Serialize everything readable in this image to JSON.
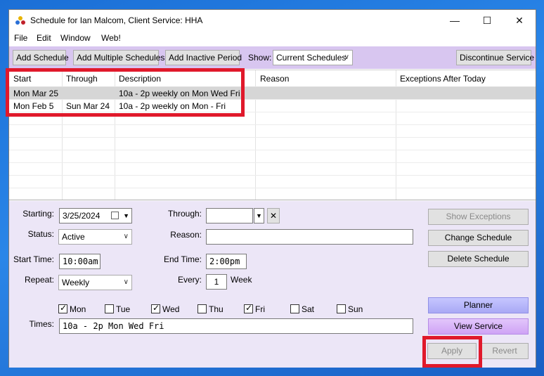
{
  "window": {
    "title": "Schedule for Ian Malcom, Client Service: HHA"
  },
  "menu": [
    "File",
    "Edit",
    "Window",
    "Web!"
  ],
  "toolbar": {
    "add_schedule": "Add Schedule",
    "add_multiple": "Add Multiple Schedules",
    "add_inactive": "Add Inactive Period",
    "show_label": "Show:",
    "show_value": "Current Schedules",
    "discontinue": "Discontinue Service"
  },
  "grid": {
    "columns": [
      "Start",
      "Through",
      "Description",
      "Reason",
      "Exceptions After Today"
    ],
    "rows": [
      {
        "start": "Mon Mar 25",
        "through": "",
        "description": "10a - 2p weekly on Mon Wed Fri",
        "reason": "",
        "exceptions": ""
      },
      {
        "start": "Mon Feb 5",
        "through": "Sun Mar 24",
        "description": "10a - 2p weekly on Mon - Fri",
        "reason": "",
        "exceptions": ""
      }
    ]
  },
  "form": {
    "starting_label": "Starting:",
    "starting_value": "3/25/2024",
    "through_label": "Through:",
    "through_value": "",
    "status_label": "Status:",
    "status_value": "Active",
    "reason_label": "Reason:",
    "reason_value": "",
    "start_time_label": "Start Time:",
    "start_time_value": "10:00am",
    "end_time_label": "End Time:",
    "end_time_value": "2:00pm",
    "repeat_label": "Repeat:",
    "repeat_value": "Weekly",
    "every_label": "Every:",
    "every_value": "1",
    "every_unit": "Week",
    "days": [
      {
        "label": "Mon",
        "checked": true
      },
      {
        "label": "Tue",
        "checked": false
      },
      {
        "label": "Wed",
        "checked": true
      },
      {
        "label": "Thu",
        "checked": false
      },
      {
        "label": "Fri",
        "checked": true
      },
      {
        "label": "Sat",
        "checked": false
      },
      {
        "label": "Sun",
        "checked": false
      }
    ],
    "times_label": "Times:",
    "times_value": "10a - 2p Mon Wed Fri"
  },
  "side_buttons": {
    "show_exceptions": "Show Exceptions",
    "change_schedule": "Change Schedule",
    "delete_schedule": "Delete Schedule",
    "planner": "Planner",
    "view_service": "View Service",
    "apply": "Apply",
    "revert": "Revert"
  },
  "colors": {
    "toolbar_bg": "#d8c6f0",
    "form_bg": "#ece6f7",
    "highlight": "#e0192b",
    "planner": "#b8b8fa",
    "view_service": "#d9b3f8"
  }
}
